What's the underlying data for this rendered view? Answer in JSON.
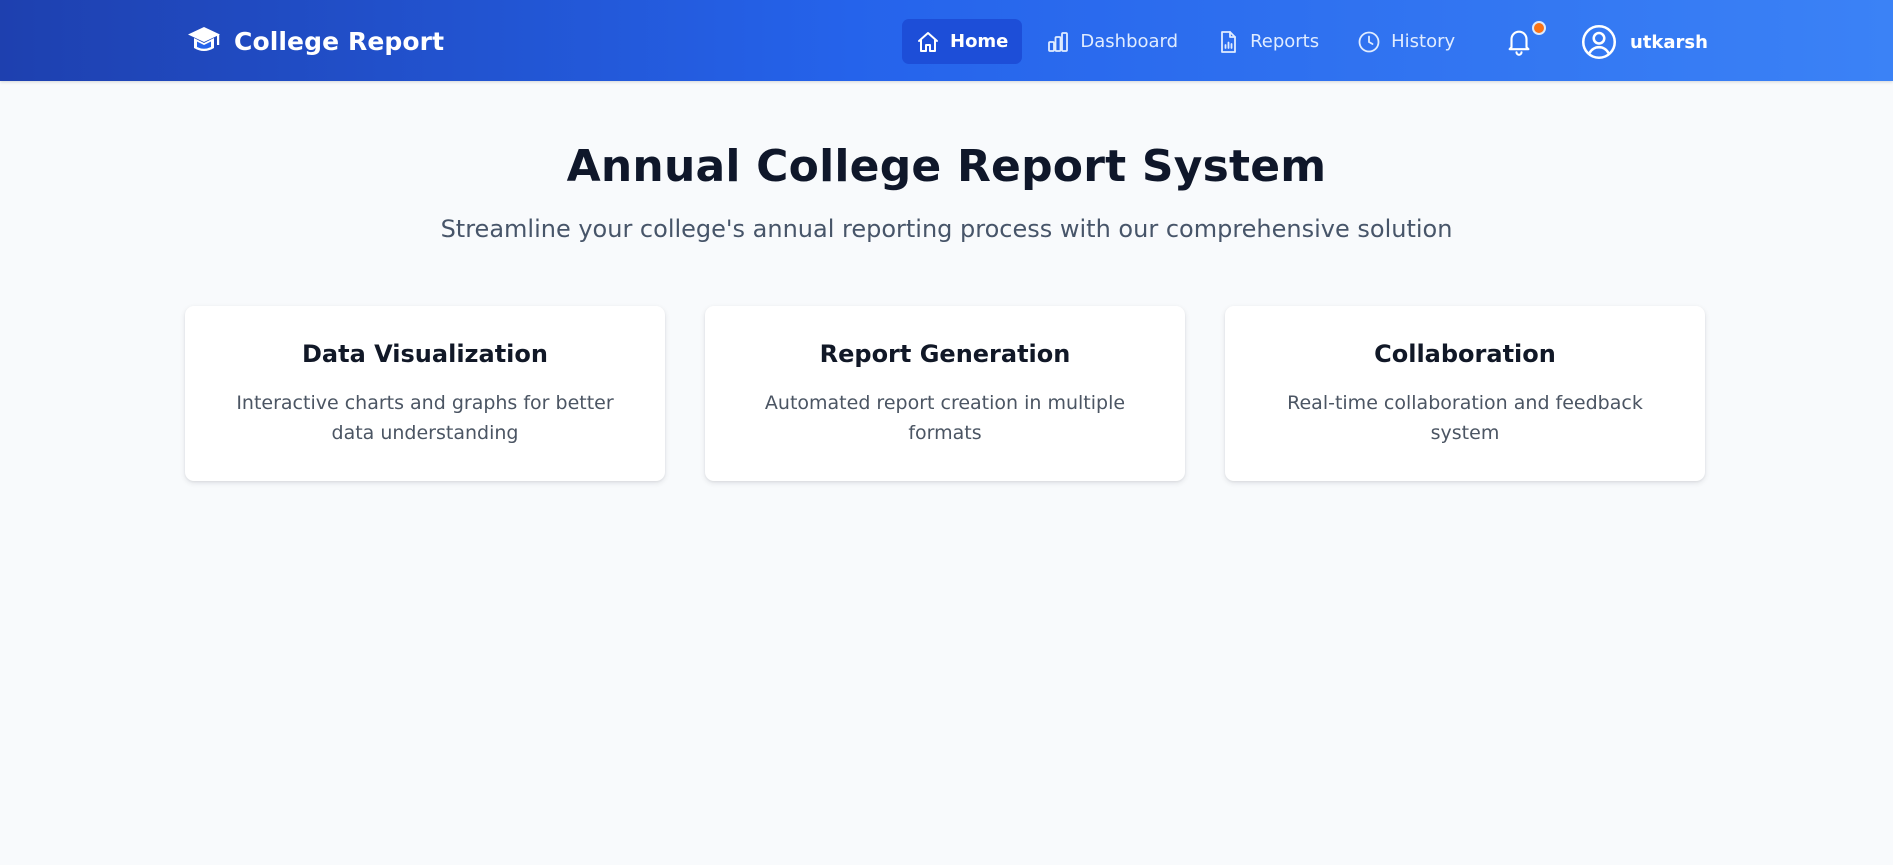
{
  "header": {
    "brand": "College Report",
    "nav": [
      {
        "label": "Home",
        "icon": "home-icon",
        "active": true
      },
      {
        "label": "Dashboard",
        "icon": "bar-chart-icon",
        "active": false
      },
      {
        "label": "Reports",
        "icon": "file-report-icon",
        "active": false
      },
      {
        "label": "History",
        "icon": "clock-icon",
        "active": false
      }
    ],
    "notifications_icon": "bell-icon",
    "user": {
      "name": "utkarsh",
      "icon": "user-circle-icon"
    }
  },
  "hero": {
    "title": "Annual College Report System",
    "subtitle": "Streamline your college's annual reporting process with our comprehensive solution"
  },
  "features": [
    {
      "title": "Data Visualization",
      "description": "Interactive charts and graphs for better data understanding"
    },
    {
      "title": "Report Generation",
      "description": "Automated report creation in multiple formats"
    },
    {
      "title": "Collaboration",
      "description": "Real-time collaboration and feedback system"
    }
  ],
  "colors": {
    "header_start": "#1e40af",
    "header_end": "#3b82f6",
    "active_nav": "#1d4ed8",
    "notification_dot": "#f97316",
    "background": "#f8fafc"
  }
}
